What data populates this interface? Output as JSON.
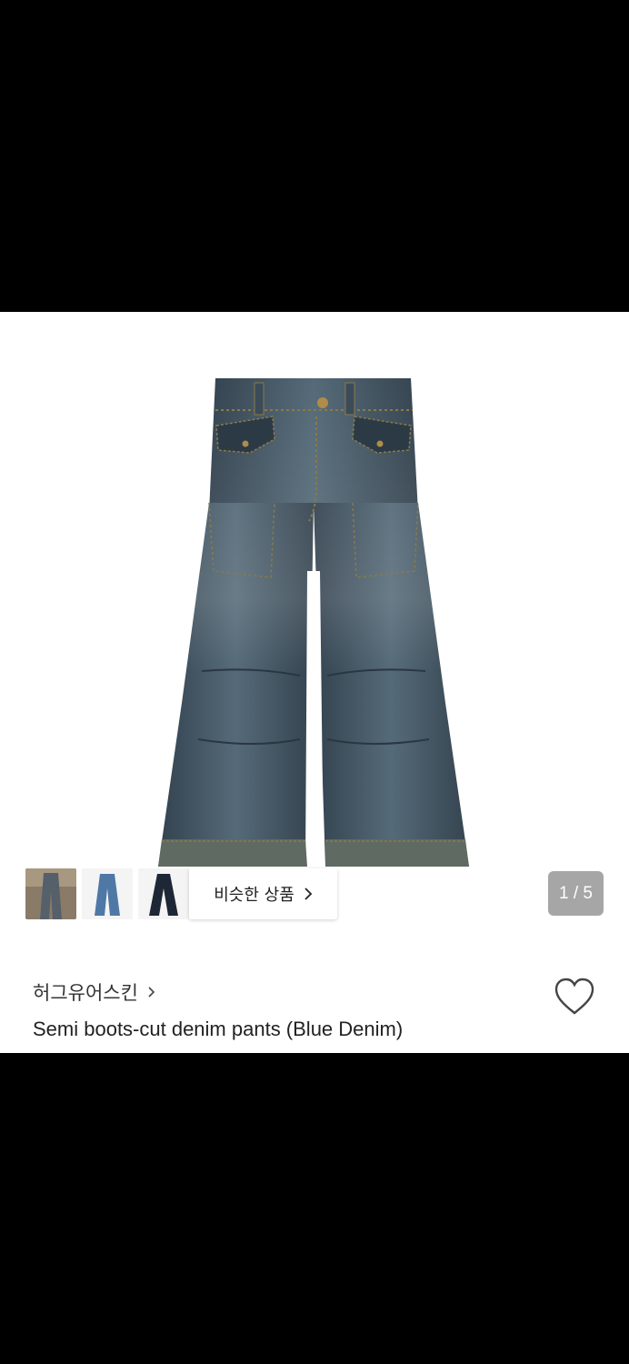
{
  "product": {
    "image_alt": "Semi boots-cut denim pants",
    "thumbnails": [
      {
        "name": "thumbnail-1"
      },
      {
        "name": "thumbnail-2"
      },
      {
        "name": "thumbnail-3"
      }
    ],
    "similar_label": "비슷한 상품",
    "counter": "1 / 5",
    "brand": "허그유어스킨",
    "title": "Semi boots-cut denim pants (Blue Denim)"
  },
  "colors": {
    "denim_dark": "#2f3f4d",
    "denim_mid": "#4a5d6b",
    "denim_light": "#6d7f8a",
    "counter_bg": "#a6a6a6"
  },
  "icons": {
    "chevron": "chevron-right-icon",
    "heart": "heart-outline-icon"
  }
}
